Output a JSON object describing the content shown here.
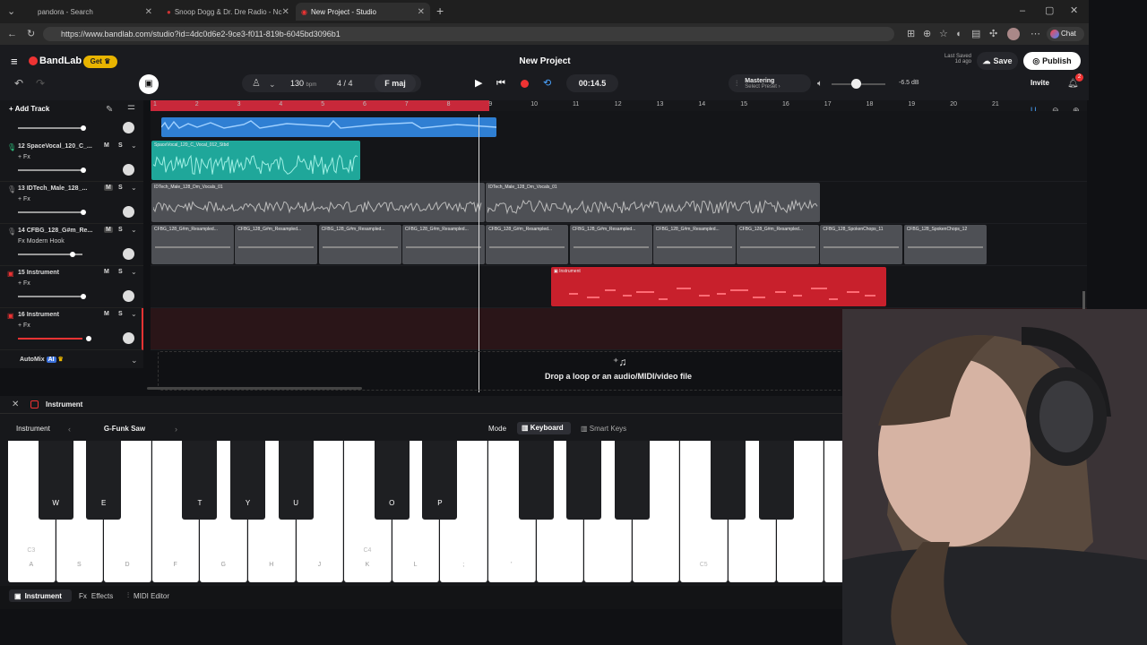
{
  "browser": {
    "tabs": [
      {
        "title": "pandora - Search"
      },
      {
        "title": "Snoop Dogg & Dr. Dre Radio - Nc"
      },
      {
        "title": "New Project - Studio"
      }
    ],
    "url": "https://www.bandlab.com/studio?id=4dc0d6e2-9ce3-f011-819b-6045bd3096b1",
    "chat_label": "Chat"
  },
  "app": {
    "logo": "BandLab",
    "get_label": "Get",
    "project_title": "New Project",
    "last_saved_line1": "Last Saved",
    "last_saved_line2": "1d ago",
    "save_label": "Save",
    "publish_label": "Publish",
    "invite_label": "Invite",
    "notif_count": "2"
  },
  "transport": {
    "tempo": "130",
    "tempo_unit": "bpm",
    "time_sig": "4 / 4",
    "key": "F maj",
    "time": "00:14.5",
    "mastering_label": "Mastering",
    "mastering_preset": "Select Preset",
    "volume_db": "-6.5 dB"
  },
  "tracks_header": {
    "add_track": "Add Track"
  },
  "ruler": [
    "1",
    "2",
    "3",
    "4",
    "5",
    "6",
    "7",
    "8",
    "9",
    "10",
    "11",
    "12",
    "13",
    "14",
    "15",
    "16",
    "17",
    "18",
    "19",
    "20",
    "21"
  ],
  "tracks": [
    {
      "name": "12  SpaceVocal_120_C_...",
      "fx": "+ Fx"
    },
    {
      "name": "13  IDTech_Male_128_...",
      "fx": "+ Fx"
    },
    {
      "name": "14  CFBG_128_G#m_Re...",
      "fx": "Fx Modern Hook"
    },
    {
      "name": "15  Instrument",
      "fx": "+ Fx"
    },
    {
      "name": "16  Instrument",
      "fx": "+ Fx"
    }
  ],
  "clips": {
    "space": "SpaceVocal_120_C_Vocal_012_Stbd",
    "idtech1": "IDTech_Male_128_Dm_Vocals_01",
    "idtech2": "IDTech_Male_128_Dm_Vocals_01",
    "cfbg": [
      "CFBG_128_G#m_Resampled...",
      "CFBG_128_G#m_Resampled...",
      "CFBG_128_G#m_Resampled...",
      "CFBG_128_G#m_Resampled...",
      "CFBG_128_G#m_Resampled...",
      "CFBG_128_G#m_Resampled...",
      "CFBG_128_G#m_Resampled...",
      "CFBG_128_G#m_Resampled...",
      "CFBG_128_SpokenChops_11",
      "CFBG_128_SpokenChops_12"
    ],
    "instrument": "Instrument"
  },
  "automix": {
    "label": "AutoMix",
    "badge": "AI"
  },
  "drop_text": "Drop a loop or an audio/MIDI/video file",
  "panel": {
    "title": "Instrument",
    "instrument_label": "Instrument",
    "preset": "G-Funk Saw",
    "mode_label": "Mode",
    "keyboard_label": "Keyboard",
    "smartkeys_label": "Smart Keys",
    "white_keys": [
      "A",
      "S",
      "D",
      "F",
      "G",
      "H",
      "J",
      "K",
      "L",
      ";",
      "'",
      "",
      "",
      "",
      "",
      "",
      "",
      ""
    ],
    "black_keys": [
      "W",
      "E",
      "T",
      "Y",
      "U",
      "O",
      "P",
      "",
      "",
      "",
      "",
      "",
      ""
    ],
    "octaves": [
      "C3",
      "C4",
      "C5"
    ],
    "tabs": [
      "Instrument",
      "Effects",
      "MIDI Editor"
    ]
  },
  "colors": {
    "accent_red": "#c8283a",
    "clip_blue": "#2f7fd3",
    "clip_teal": "#1fa79a",
    "clip_grey": "#55575c",
    "clip_red": "#c8202c"
  }
}
